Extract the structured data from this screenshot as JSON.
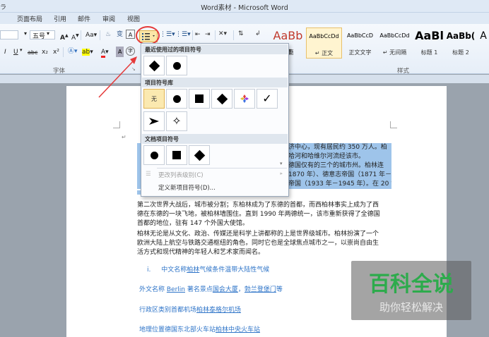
{
  "window": {
    "title": "Word素材 - Microsoft Word",
    "sys_icon": "ラ"
  },
  "menus": [
    "页面布局",
    "引用",
    "邮件",
    "审阅",
    "视图"
  ],
  "ribbon": {
    "font_size": "五号",
    "grow_font": "A",
    "shrink_font": "A",
    "change_case": "Aa",
    "italic": "I",
    "underline": "U",
    "strike": "abc",
    "subscript": "x₂",
    "superscript": "x²",
    "font_color": "A",
    "highlight": "ab",
    "font_group_label": "字体",
    "style_group_label": "样式",
    "styles": [
      {
        "sample": "AaBb",
        "name": "标题"
      },
      {
        "sample": "AaBbCcDd",
        "name": "正文"
      },
      {
        "sample": "AaBbCcD",
        "name": "正文文字"
      },
      {
        "sample": "AaBbCcDd",
        "name": "无间隔"
      },
      {
        "sample": "AaBl",
        "name": "标题 1"
      },
      {
        "sample": "AaBb(",
        "name": "标题 2"
      },
      {
        "sample": "A",
        "name": ""
      }
    ]
  },
  "dropdown": {
    "recent_header": "最近使用过的项目符号",
    "library_header": "项目符号库",
    "doc_header": "文档项目符号",
    "none_label": "无",
    "change_level": "更改列表级别(C)",
    "define_new": "定义新项目符号(D)..."
  },
  "document": {
    "sel_line_1": "济中心，现有居民约 350 万人。柏",
    "sel_line_2": "哈河和哈维尔河流经该市。",
    "sel_line_3": "德国仅有的三个的城市州。柏林连",
    "sel_line_4": "1870 年）、德意志帝国（1871 年－",
    "sel_line_5": "帝国（1933 年－1945 年）。在 20 世",
    "p2_line_1": "第二次世界大战后，城市被分割；东柏林成为了东德的首都，而西柏林事实上成为了西",
    "p2_line_2": "德在东德的一块飞地，被柏林墙围住。直到 1990 年两德统一，该市重新获得了全德国",
    "p2_line_3": "首都的地位，驻有 147 个外国大使馆。",
    "p3_line_1": "柏林无论是从文化、政治、传媒还是科学上讲都称的上是世界级城市。柏林扮演了一个",
    "p3_line_2": "欧洲大陆上航空与铁路交通枢纽的角色，同时它也是全球焦点城市之一，以崇尚自由生",
    "p3_line_3": "活方式和现代精神的年轻人和艺术家而闻名。",
    "list_num": "i.",
    "list_pre": "中文名称",
    "list_link": "柏林",
    "list_rest": "气候条件温带大陆性气候",
    "f1_pre": "外文名称 ",
    "f1_link1": "Berlin",
    "f1_mid": " 著名景点",
    "f1_link2": "国会大厦",
    "f1_sep": "，",
    "f1_link3": "勃兰登堡门",
    "f1_end": "等",
    "f2_pre": "行政区类别首都机场",
    "f2_link": "柏林泰格尔机场",
    "f3_pre": "地理位置德国东北部火车站",
    "f3_link": "柏林中央火车站"
  },
  "watermark": {
    "title": "百科全说",
    "subtitle": "助你轻松解决"
  },
  "colors": {
    "accent_red": "#e53a3a",
    "link_blue": "#2e74c8",
    "selection": "#9ec4ea",
    "watermark_green": "#2dab4c"
  }
}
